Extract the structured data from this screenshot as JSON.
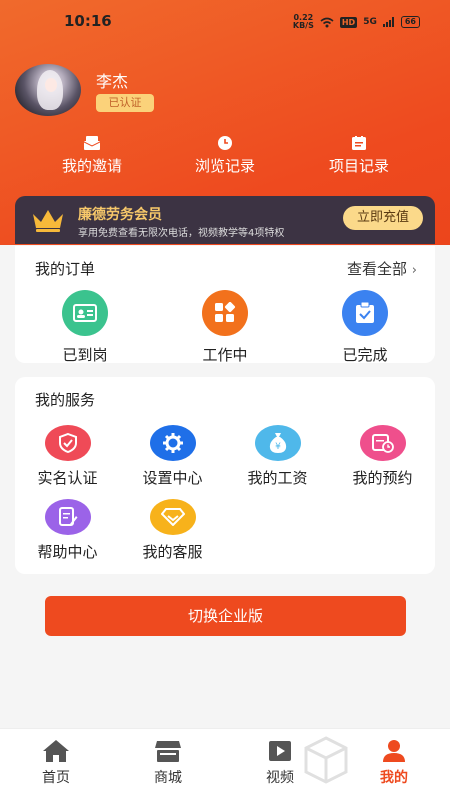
{
  "status_bar": {
    "time": "10:16",
    "net_speed": "0.22",
    "net_unit": "KB/S",
    "hd": "HD",
    "signal": "5G",
    "battery": "66"
  },
  "profile": {
    "name": "李杰",
    "verified_label": "已认证"
  },
  "quick_links": [
    {
      "label": "我的邀请",
      "icon": "invitation-icon"
    },
    {
      "label": "浏览记录",
      "icon": "clock-icon"
    },
    {
      "label": "项目记录",
      "icon": "project-icon"
    }
  ],
  "membership": {
    "title": "廉德劳务会员",
    "description": "享用免费查看无限次电话，视频教学等4项特权",
    "button": "立即充值",
    "icon": "crown-icon"
  },
  "orders": {
    "title": "我的订单",
    "view_all": "查看全部",
    "items": [
      {
        "label": "已到岗",
        "icon": "id-card-icon",
        "color": "#3bc38e"
      },
      {
        "label": "工作中",
        "icon": "apps-icon",
        "color": "#f2711c"
      },
      {
        "label": "已完成",
        "icon": "clipboard-check-icon",
        "color": "#3b82f0"
      }
    ]
  },
  "services": {
    "title": "我的服务",
    "items": [
      {
        "label": "实名认证",
        "icon": "shield-icon",
        "color": "#ef4a57"
      },
      {
        "label": "设置中心",
        "icon": "gear-icon",
        "color": "#1f6fe8"
      },
      {
        "label": "我的工资",
        "icon": "money-bag-icon",
        "color": "#4fb8ea"
      },
      {
        "label": "我的预约",
        "icon": "calendar-clock-icon",
        "color": "#ef4f8c"
      },
      {
        "label": "帮助中心",
        "icon": "document-edit-icon",
        "color": "#9b63e8"
      },
      {
        "label": "我的客服",
        "icon": "diamond-icon",
        "color": "#f7b21b"
      }
    ]
  },
  "switch_button": "切换企业版",
  "tabs": [
    {
      "label": "首页",
      "icon": "home-icon",
      "active": false
    },
    {
      "label": "商城",
      "icon": "store-icon",
      "active": false
    },
    {
      "label": "视频",
      "icon": "video-icon",
      "active": false
    },
    {
      "label": "我的",
      "icon": "user-icon",
      "active": true
    }
  ],
  "colors": {
    "primary": "#ee4a1f",
    "member_bg": "#3c3343",
    "gold": "#f7c86a"
  }
}
